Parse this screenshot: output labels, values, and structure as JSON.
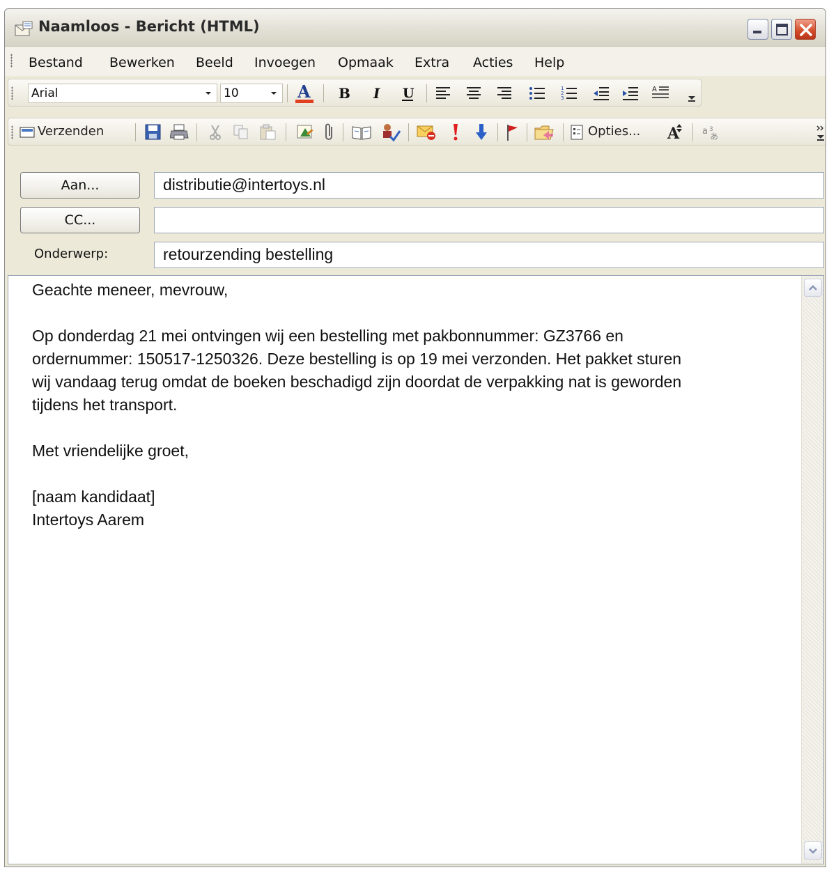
{
  "window": {
    "title": "Naamloos - Bericht (HTML)"
  },
  "menu": {
    "items": [
      "Bestand",
      "Bewerken",
      "Beeld",
      "Invoegen",
      "Opmaak",
      "Extra",
      "Acties",
      "Help"
    ]
  },
  "format_toolbar": {
    "font": "Arial",
    "size": "10",
    "text_color": "#e04020"
  },
  "standard_toolbar": {
    "send_label": "Verzenden",
    "options_label": "Opties..."
  },
  "header": {
    "to_button": "Aan...",
    "cc_button": "CC...",
    "subject_label": "Onderwerp:",
    "to_value": "distributie@intertoys.nl",
    "cc_value": "",
    "subject_value": "retourzending bestelling"
  },
  "body": {
    "greeting": "Geachte meneer, mevrouw,",
    "paragraph_lines": [
      "Op donderdag 21 mei ontvingen wij een bestelling met pakbonnummer: GZ3766 en",
      "ordernummer: 150517-1250326. Deze bestelling is op 19 mei verzonden. Het pakket sturen",
      "wij vandaag terug omdat de boeken beschadigd zijn doordat de verpakking nat is geworden",
      "tijdens het transport."
    ],
    "closing": "Met vriendelijke groet,",
    "signature_name": "[naam kandidaat]",
    "signature_company": "Intertoys Aarem"
  }
}
